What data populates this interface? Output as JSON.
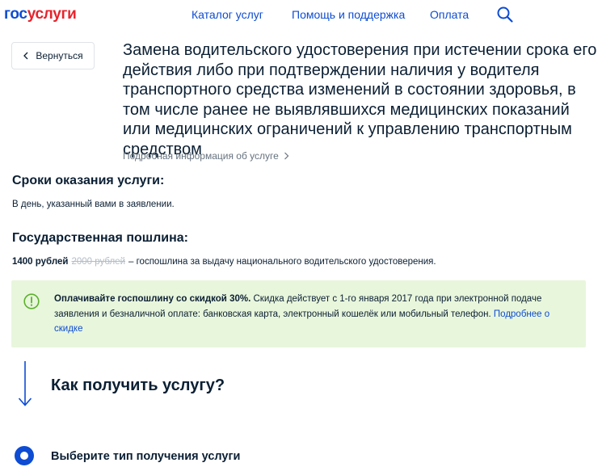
{
  "header": {
    "logo_part1": "гос",
    "logo_part2": "услуги",
    "nav": [
      "Каталог услуг",
      "Помощь и поддержка",
      "Оплата"
    ],
    "search_icon": "search-icon"
  },
  "back_button": {
    "label": "Вернуться",
    "icon": "chevron-left-icon"
  },
  "service": {
    "title": "Замена водительского удостоверения при истечении срока его действия либо при подтверждении наличия у водителя транспортного средства изменений в состоянии здоровья, в том числе ранее не выявлявшихся медицинских показаний или медицинских ограничений к управлению транспортным средством",
    "details_link": "Подробная информация об услуге"
  },
  "terms": {
    "heading": "Сроки оказания услуги:",
    "text": "В день, указанный вами в заявлении."
  },
  "fee": {
    "heading": "Государственная пошлина:",
    "amount": "1400 рублей",
    "old_amount": "2000 рублей",
    "description": "– госпошлина за выдачу национального водительского удостоверения."
  },
  "discount": {
    "bold": "Оплачивайте госпошлину со скидкой 30%.",
    "text": " Скидка действует с 1-го января 2017 года при электронной подаче заявления и безналичной оплате: банковская карта, электронный кошелёк или мобильный телефон. ",
    "link": "Подробнее о скидке",
    "colors": {
      "background": "#e8f6dc",
      "icon": "#5cb12c"
    }
  },
  "how_to": {
    "heading": "Как получить услугу?",
    "step_label": "Выберите тип получения услуги"
  },
  "colors": {
    "primary": "#0d4cd3",
    "brand_red": "#e7232c",
    "text": "#0b1f33",
    "muted": "#66727f"
  }
}
